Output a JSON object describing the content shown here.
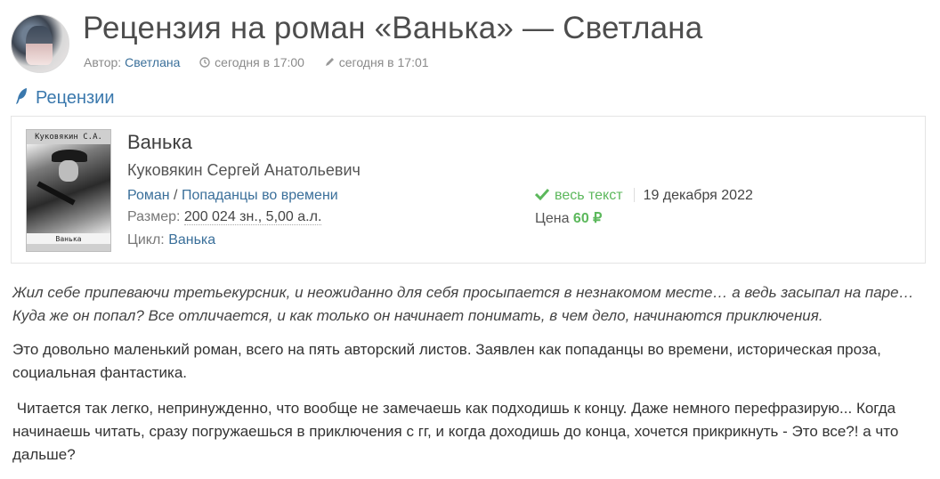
{
  "header": {
    "title": "Рецензия на роман «Ванька» — Светлана",
    "author_label": "Автор:",
    "author_name": "Светлана",
    "created": "сегодня в 17:00",
    "edited": "сегодня в 17:01"
  },
  "section": {
    "label": "Рецензии"
  },
  "book": {
    "cover_author": "Куковякин С.А.",
    "cover_title": "Ванька",
    "title": "Ванька",
    "author": "Куковякин Сергей Анатольевич",
    "form": "Роман",
    "genre_sep": " / ",
    "genre": "Попаданцы во времени",
    "size_label": "Размер:",
    "size_value": "200 024 зн., 5,00 а.л.",
    "cycle_label": "Цикл:",
    "cycle_value": "Ванька",
    "status": "весь текст",
    "date": "19 декабря 2022",
    "price_label": "Цена",
    "price_value": "60 ₽"
  },
  "review": {
    "intro": "Жил себе припеваючи третьекурсник, и неожиданно для себя просыпается в незнакомом месте… а ведь засыпал на паре… Куда же он попал? Все отличается, и как только он начинает понимать, в чем дело, начинаются приключения.",
    "p1": "Это довольно маленький роман, всего на пять авторский листов. Заявлен как попаданцы во времени, историческая проза, социальная фантастика.",
    "p2": " Читается так легко, непринужденно, что вообще не замечаешь как подходишь к концу. Даже немного перефразирую... Когда начинаешь читать, сразу погружаешься в приключения с гг, и когда доходишь до конца, хочется прикрикнуть - Это все?! а что дальше?"
  },
  "colors": {
    "link": "#3a6f9a",
    "accent_green": "#5cb85c",
    "title": "#4d4d4d"
  }
}
